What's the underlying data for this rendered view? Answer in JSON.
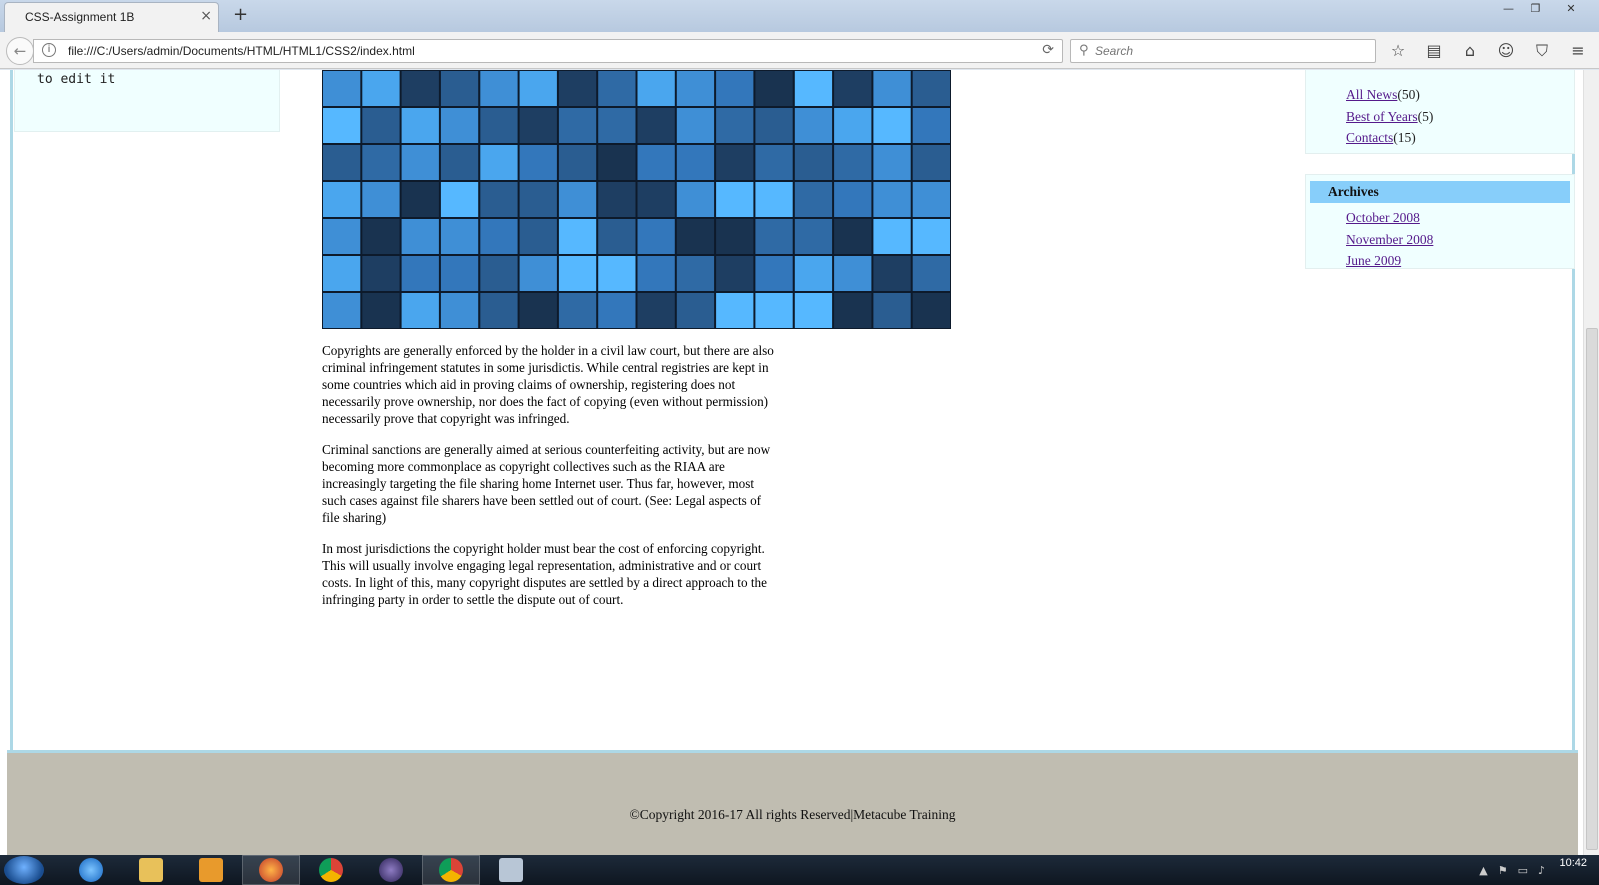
{
  "browser": {
    "tab_title": "CSS-Assignment 1B",
    "tab_close": "×",
    "new_tab": "+",
    "url": "file:///C:/Users/admin/Documents/HTML/HTML1/CSS2/index.html",
    "search_placeholder": "Search",
    "window_buttons": [
      "—",
      "❐",
      "✕"
    ],
    "toolbar_icons": [
      "bookmark-star-icon",
      "reading-list-icon",
      "home-icon",
      "emoji-icon",
      "pocket-icon",
      "menu-icon"
    ]
  },
  "page": {
    "left_box_text": "to edit it",
    "mosaic_colors": [
      "#1e3e62",
      "#2a5d91",
      "#3377bb",
      "#3f8fd6",
      "#4aa6ee",
      "#56b8ff",
      "#193350",
      "#2f6aa5"
    ],
    "article_paragraphs": [
      "Copyrights are generally enforced by the holder in a civil law court, but there are also criminal infringement statutes in some jurisdictis. While central registries are kept in some countries which aid in proving claims of ownership, registering does not necessarily prove ownership, nor does the fact of copying (even without permission) necessarily prove that copyright was infringed.",
      "Criminal sanctions are generally aimed at serious counterfeiting activity, but are now becoming more commonplace as copyright collectives such as the RIAA are increasingly targeting the file sharing home Internet user. Thus far, however, most such cases against file sharers have been settled out of court. (See: Legal aspects of file sharing)",
      "In most jurisdictions the copyright holder must bear the cost of enforcing copyright. This will usually involve engaging legal representation, administrative and or court costs. In light of this, many copyright disputes are settled by a direct approach to the infringing party in order to settle the dispute out of court."
    ],
    "categories": [
      {
        "link": "All News",
        "count": "(50)"
      },
      {
        "link": "Best of Years",
        "count": "(5)"
      },
      {
        "link": "Contacts",
        "count": "(15)"
      }
    ],
    "archives": {
      "heading": "Archives",
      "items": [
        "October 2008",
        "November 2008",
        "June 2009"
      ]
    },
    "footer": "©Copyright 2016-17 All rights Reserved|Metacube Training"
  },
  "taskbar": {
    "clock": "10:42"
  }
}
